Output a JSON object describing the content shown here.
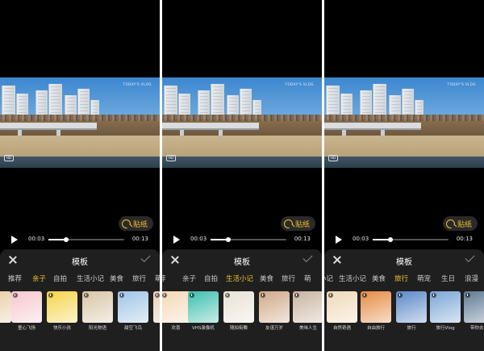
{
  "video": {
    "watermark": "TODAY'S VLOG",
    "hd_badge": "HD"
  },
  "player": {
    "current_time": "00:03",
    "total_time": "00:13",
    "progress": 0.23
  },
  "sticker_button": {
    "label": "贴纸",
    "icon": "sticker-icon"
  },
  "sheet": {
    "title": "模板"
  },
  "colors": {
    "accent": "#f2c12e",
    "sheet_bg": "#1f1f1f"
  },
  "panels": [
    {
      "tabs": [
        "推荐",
        "亲子",
        "自拍",
        "生活小记",
        "美食",
        "旅行",
        "萌"
      ],
      "selected_tab": "亲子",
      "templates": [
        "",
        "童心飞扬",
        "快乐小孩",
        "阳光物语",
        "甜空飞鸟",
        ""
      ]
    },
    {
      "tabs": [
        "荐",
        "亲子",
        "自拍",
        "生活小记",
        "美食",
        "旅行",
        "萌"
      ],
      "selected_tab": "生活小记",
      "templates": [
        "欢喜",
        "VHS录像机",
        "随拍街舞",
        "友谊万岁",
        "美味人生"
      ]
    },
    {
      "tabs": [
        "小记",
        "生活小记",
        "美食",
        "旅行",
        "萌宠",
        "生日",
        "浪漫"
      ],
      "selected_tab": "旅行",
      "templates": [
        "自然奇遇",
        "自由旅行",
        "旅行",
        "旅行Vlog",
        "带你去旅"
      ]
    }
  ]
}
